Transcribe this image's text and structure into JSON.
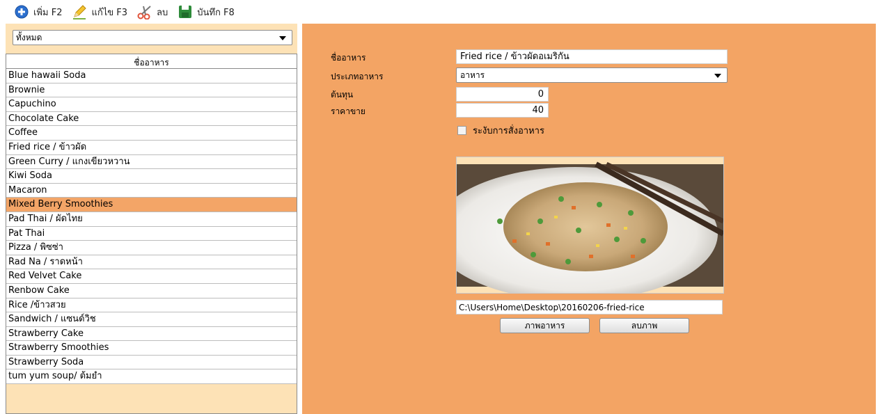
{
  "toolbar": {
    "add_label": "เพิ่ม F2",
    "edit_label": "แก้ไข F3",
    "delete_label": "ลบ",
    "save_label": "บันทึก F8"
  },
  "sidebar": {
    "category_selected": "ทั้งหมด",
    "list_header": "ชื่ออาหาร",
    "items": [
      "Blue hawaii Soda",
      "Brownie",
      "Capuchino",
      "Chocolate Cake",
      "Coffee",
      "Fried rice / ข้าวผัด",
      "Green Curry / แกงเขียวหวาน",
      "Kiwi Soda",
      "Macaron",
      "Mixed Berry Smoothies",
      "Pad Thai / ผัดไทย",
      "Pat Thai",
      "Pizza / พิซซ่า",
      "Rad Na / ราดหน้า",
      "Red Velvet Cake",
      "Renbow Cake",
      "Rice /ข้าวสวย",
      "Sandwich / แซนด์วิช",
      "Strawberry Cake",
      "Strawberry Smoothies",
      "Strawberry Soda",
      "tum yum soup/ ต้มยำ"
    ],
    "selected_index": 9
  },
  "form": {
    "name_label": "ชื่ออาหาร",
    "name_value": "Fried rice / ข้าวผัดอเมริกัน",
    "type_label": "ประเภทอาหาร",
    "type_value": "อาหาร",
    "cost_label": "ต้นทุน",
    "cost_value": "0",
    "price_label": "ราคาขาย",
    "price_value": "40",
    "suspend_label": "ระงับการสั่งอาหาร",
    "image_path": "C:\\Users\\Home\\Desktop\\20160206-fried-rice",
    "image_button": "ภาพอาหาร",
    "delete_image_button": "ลบภาพ"
  },
  "colors": {
    "right_panel_bg": "#f3a464",
    "left_panel_bg": "#fde2b6",
    "selected_row": "#f3a567"
  },
  "icons": {
    "add": "plus-circle-icon",
    "edit": "pencil-icon",
    "delete": "scissors-icon",
    "save": "floppy-disk-icon"
  }
}
